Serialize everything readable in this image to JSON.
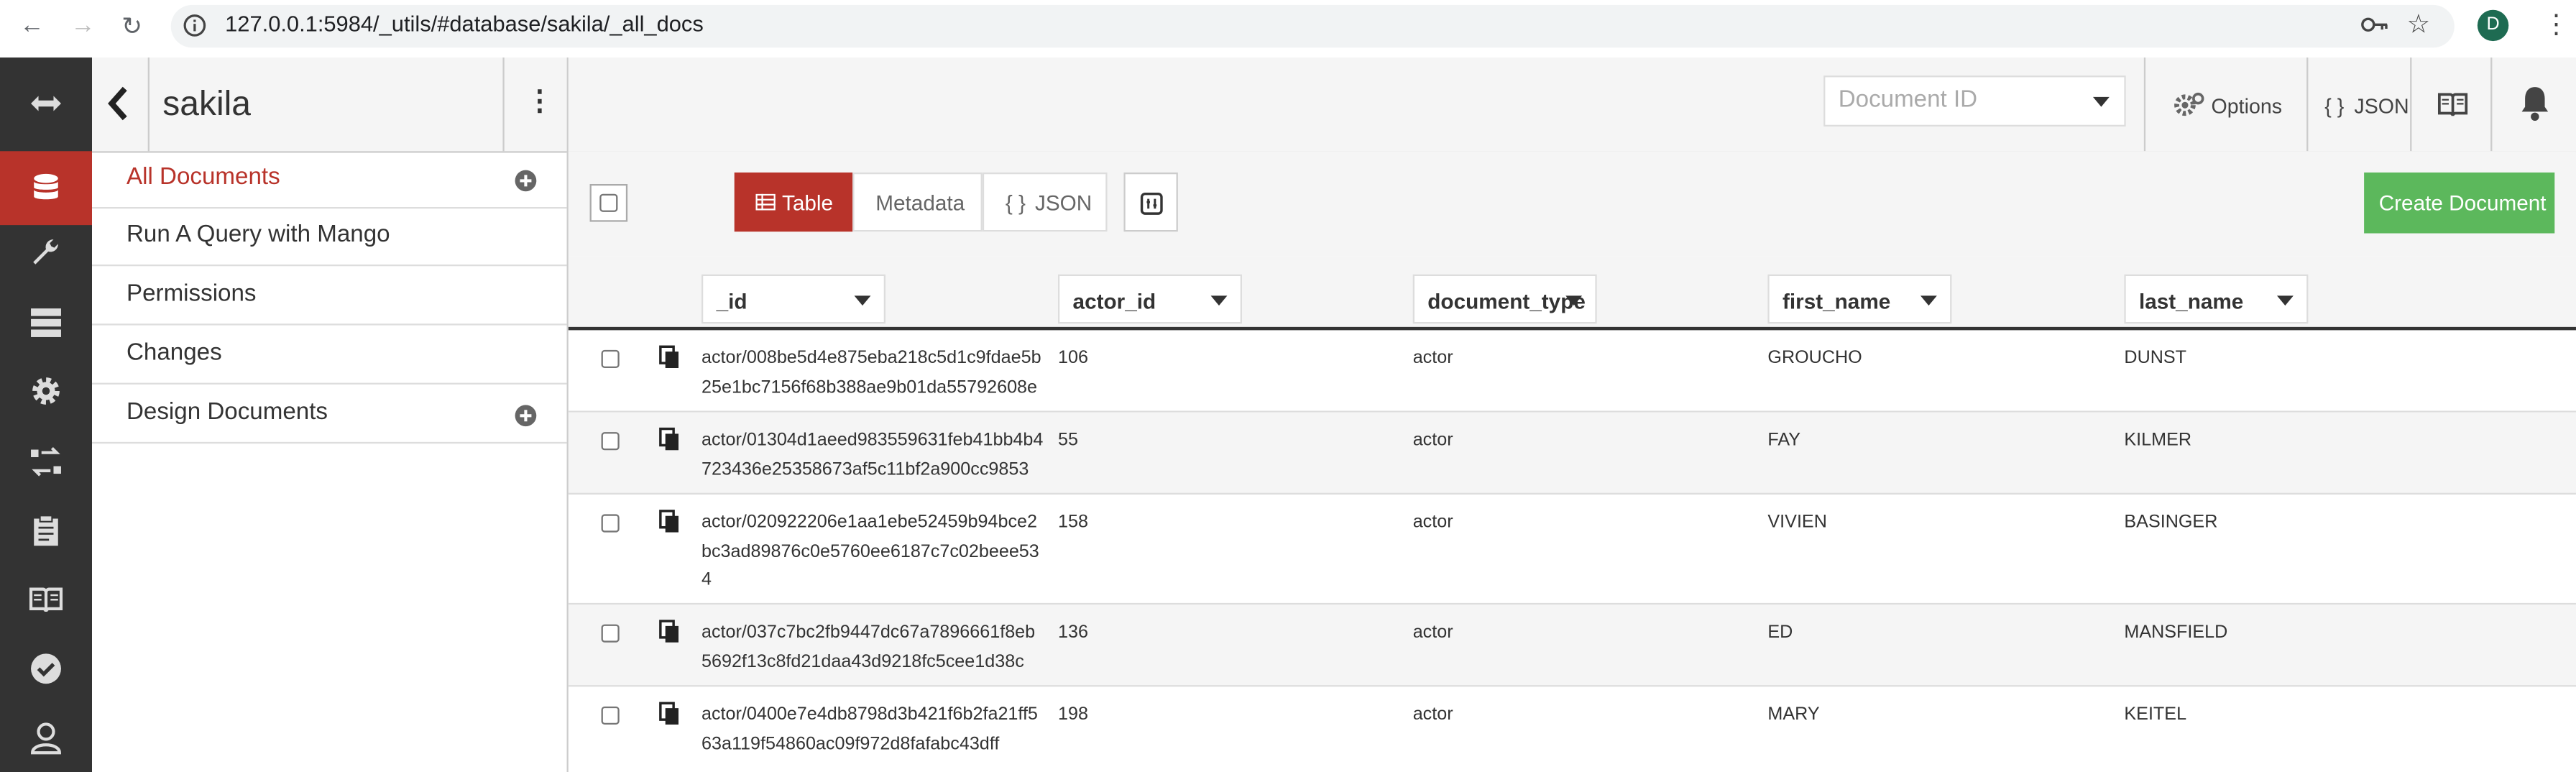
{
  "browser": {
    "url": "127.0.0.1:5984/_utils/#database/sakila/_all_docs",
    "profile_initial": "D"
  },
  "nav_icons": [
    "expand-arrows-icon",
    "database-icon",
    "wrench-icon",
    "server-icon",
    "gear-icon",
    "replication-icon",
    "clipboard-icon",
    "book-icon",
    "checkmark-icon",
    "user-icon"
  ],
  "sidebar": {
    "db_name": "sakila",
    "items": [
      {
        "label": "All Documents",
        "active": true
      },
      {
        "label": "Run A Query with Mango"
      },
      {
        "label": "Permissions"
      },
      {
        "label": "Changes"
      },
      {
        "label": "Design Documents"
      }
    ]
  },
  "topbar": {
    "doc_id_placeholder": "Document ID",
    "options_label": "Options",
    "json_label": "JSON"
  },
  "toolbar": {
    "table_label": "Table",
    "metadata_label": "Metadata",
    "json_label": "JSON",
    "json_braces": "{ }",
    "create_label": "Create Document"
  },
  "columns": [
    "_id",
    "actor_id",
    "document_type",
    "first_name",
    "last_name"
  ],
  "rows": [
    {
      "id": [
        "actor/008be5d4e875eba218c5d1c9fdae5b",
        "25e1bc7156f68b388ae9b01da55792608e"
      ],
      "actor_id": "106",
      "document_type": "actor",
      "first_name": "GROUCHO",
      "last_name": "DUNST"
    },
    {
      "id": [
        "actor/01304d1aeed983559631feb41bb4b4",
        "723436e25358673af5c11bf2a900cc9853"
      ],
      "actor_id": "55",
      "document_type": "actor",
      "first_name": "FAY",
      "last_name": "KILMER"
    },
    {
      "id": [
        "actor/020922206e1aa1ebe52459b94bce2",
        "bc3ad89876c0e5760ee6187c7c02beee53",
        "4"
      ],
      "actor_id": "158",
      "document_type": "actor",
      "first_name": "VIVIEN",
      "last_name": "BASINGER"
    },
    {
      "id": [
        "actor/037c7bc2fb9447dc67a7896661f8eb",
        "5692f13c8fd21daa43d9218fc5cee1d38c"
      ],
      "actor_id": "136",
      "document_type": "actor",
      "first_name": "ED",
      "last_name": "MANSFIELD"
    },
    {
      "id": [
        "actor/0400e7e4db8798d3b421f6b2fa21ff5",
        "63a119f54860ac09f972d8fafabc43dff"
      ],
      "actor_id": "198",
      "document_type": "actor",
      "first_name": "MARY",
      "last_name": "KEITEL"
    }
  ],
  "colors": {
    "accent": "#b8332a",
    "create_button": "#5cb85c",
    "nav_bg": "#333333"
  }
}
